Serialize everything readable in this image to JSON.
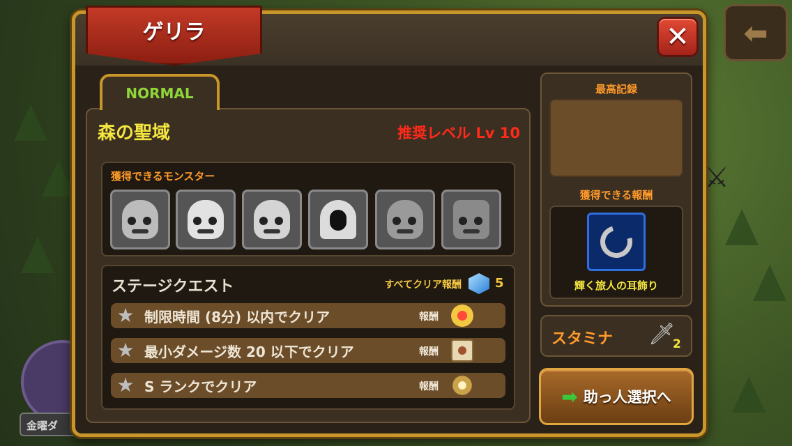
{
  "window": {
    "title": "ゲリラ"
  },
  "background": {
    "banner_label": "金曜ダ"
  },
  "tab": {
    "difficulty_label": "NORMAL"
  },
  "stage": {
    "name": "森の聖域",
    "recommended_level": "推奨レベル Lv 10"
  },
  "monsters": {
    "title": "獲得できるモンスター",
    "items": [
      {
        "icon": "zombie-monster-icon"
      },
      {
        "icon": "skeleton-monster-icon"
      },
      {
        "icon": "skeleton-warrior-monster-icon"
      },
      {
        "icon": "hooded-ghost-monster-icon"
      },
      {
        "icon": "horned-demon-monster-icon"
      },
      {
        "icon": "rock-golem-monster-icon"
      }
    ]
  },
  "quests": {
    "title": "ステージクエスト",
    "all_clear_label": "すべてクリア報酬",
    "all_clear_count": "5",
    "all_clear_icon": "blue-gem-icon",
    "reward_label": "報酬",
    "items": [
      {
        "text": "制限時間 (8分) 以内でクリア",
        "reward_icon": "gold-coin-icon"
      },
      {
        "text": "最小ダメージ数 20 以下でクリア",
        "reward_icon": "scroll-icon"
      },
      {
        "text": "S ランクでクリア",
        "reward_icon": "ring-icon"
      }
    ]
  },
  "record": {
    "title": "最高記録",
    "value": ""
  },
  "reward": {
    "title": "獲得できる報酬",
    "item_name": "輝く旅人の耳飾り",
    "item_icon": "earring-icon"
  },
  "stamina": {
    "label": "スタミナ",
    "value": "2",
    "icon": "sword-icon"
  },
  "helper_button": {
    "label": "助っ人選択へ"
  },
  "colors": {
    "accent_gold": "#c9962a",
    "title_red": "#c23a26",
    "level_red": "#ff2a1a",
    "stage_yellow": "#f5e640",
    "section_orange": "#ff9a2a",
    "normal_green": "#8fd63a"
  }
}
